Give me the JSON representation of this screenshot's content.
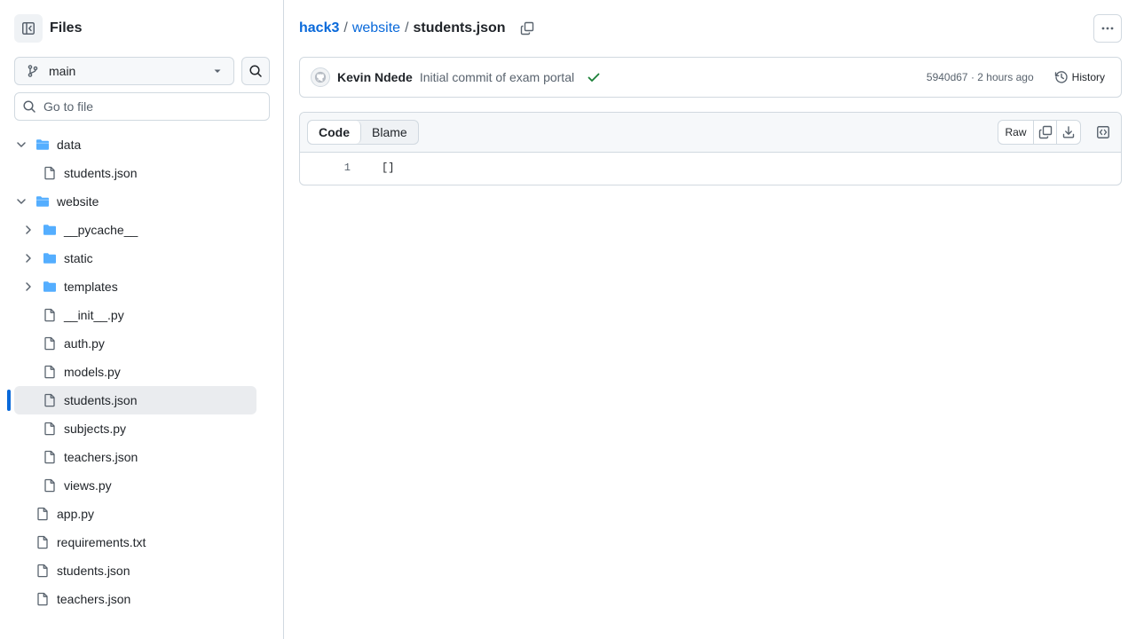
{
  "sidebar": {
    "title": "Files",
    "branch": "main",
    "goto_placeholder": "Go to file",
    "tree": [
      {
        "label": "data",
        "type": "folder",
        "state": "expanded",
        "depth": 0
      },
      {
        "label": "students.json",
        "type": "file",
        "depth": 1
      },
      {
        "label": "website",
        "type": "folder",
        "state": "expanded",
        "depth": 0
      },
      {
        "label": "__pycache__",
        "type": "folder",
        "state": "collapsed",
        "depth": 1
      },
      {
        "label": "static",
        "type": "folder",
        "state": "collapsed",
        "depth": 1
      },
      {
        "label": "templates",
        "type": "folder",
        "state": "collapsed",
        "depth": 1
      },
      {
        "label": "__init__.py",
        "type": "file",
        "depth": 1
      },
      {
        "label": "auth.py",
        "type": "file",
        "depth": 1
      },
      {
        "label": "models.py",
        "type": "file",
        "depth": 1
      },
      {
        "label": "students.json",
        "type": "file",
        "depth": 1,
        "selected": true
      },
      {
        "label": "subjects.py",
        "type": "file",
        "depth": 1
      },
      {
        "label": "teachers.json",
        "type": "file",
        "depth": 1
      },
      {
        "label": "views.py",
        "type": "file",
        "depth": 1
      },
      {
        "label": "app.py",
        "type": "file",
        "depth": 0
      },
      {
        "label": "requirements.txt",
        "type": "file",
        "depth": 0
      },
      {
        "label": "students.json",
        "type": "file",
        "depth": 0
      },
      {
        "label": "teachers.json",
        "type": "file",
        "depth": 0
      }
    ]
  },
  "breadcrumb": {
    "repo": "hack3",
    "folder": "website",
    "file": "students.json",
    "separator": "/"
  },
  "commit": {
    "author": "Kevin Ndede",
    "message": "Initial commit of exam portal",
    "meta": "5940d67 · 2 hours ago",
    "history_label": "History"
  },
  "file_view": {
    "tabs": [
      "Code",
      "Blame"
    ],
    "active_tab": "Code",
    "raw_label": "Raw",
    "lines": [
      {
        "number": "1",
        "text": "[]"
      }
    ]
  },
  "colors": {
    "accent": "#0969da",
    "folder": "#54aeff",
    "success": "#1a7f37"
  }
}
